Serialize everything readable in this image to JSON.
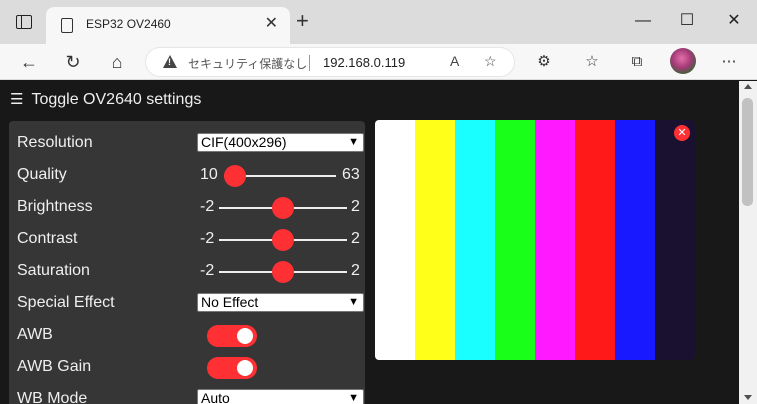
{
  "browser": {
    "tab_title": "ESP32 OV2460",
    "tab_close": "✕",
    "new_tab": "+",
    "security_label": "セキュリティ保護なし",
    "url": "192.168.0.119",
    "window_controls": {
      "minimize": "—",
      "maximize": "☐",
      "close": "✕"
    }
  },
  "page": {
    "menu_label": "Toggle OV2640 settings",
    "accent_color": "#ff3034",
    "settings": {
      "resolution": {
        "label": "Resolution",
        "value": "CIF(400x296)"
      },
      "quality": {
        "label": "Quality",
        "min": "10",
        "max": "63",
        "value": 10
      },
      "brightness": {
        "label": "Brightness",
        "min": "-2",
        "max": "2",
        "value": 0
      },
      "contrast": {
        "label": "Contrast",
        "min": "-2",
        "max": "2",
        "value": 0
      },
      "saturation": {
        "label": "Saturation",
        "min": "-2",
        "max": "2",
        "value": 0
      },
      "special_effect": {
        "label": "Special Effect",
        "value": "No Effect"
      },
      "awb": {
        "label": "AWB",
        "on": true
      },
      "awb_gain": {
        "label": "AWB Gain",
        "on": true
      },
      "wb_mode": {
        "label": "WB Mode",
        "value": "Auto"
      }
    },
    "stream": {
      "close_label": "✕",
      "color_bars": [
        "#ffffff",
        "#ffff19",
        "#19ffff",
        "#19ff19",
        "#ff19ff",
        "#ff1919",
        "#1919ff",
        "#1a1030"
      ]
    }
  }
}
